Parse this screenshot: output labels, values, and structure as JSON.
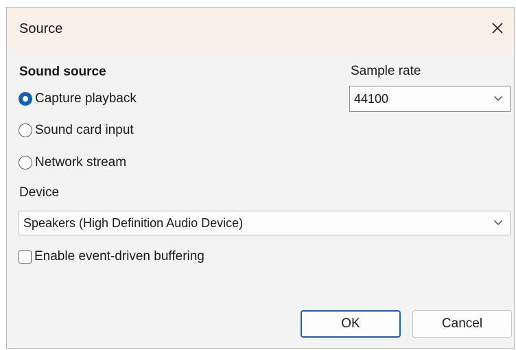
{
  "window": {
    "title": "Source",
    "close_icon": "close-icon"
  },
  "sound_source": {
    "title": "Sound source",
    "options": [
      {
        "label": "Capture playback",
        "checked": true
      },
      {
        "label": "Sound card input",
        "checked": false
      },
      {
        "label": "Network stream",
        "checked": false
      }
    ]
  },
  "sample_rate": {
    "label": "Sample rate",
    "value": "44100",
    "icon": "chevron-down-icon"
  },
  "device": {
    "label": "Device",
    "value": "Speakers (High Definition Audio Device)",
    "icon": "chevron-down-icon"
  },
  "buffering": {
    "label": "Enable event-driven buffering",
    "checked": false
  },
  "buttons": {
    "ok": "OK",
    "cancel": "Cancel"
  },
  "colors": {
    "accent": "#1a5fb4",
    "titlebar": "#f9f0e8",
    "dialog_bg": "#f3f3f3"
  }
}
